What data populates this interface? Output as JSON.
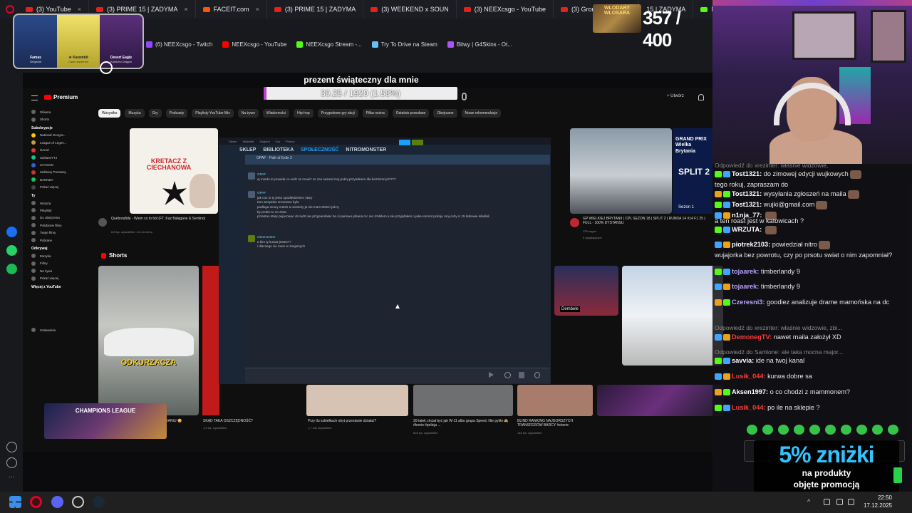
{
  "browser": {
    "tabs": [
      {
        "label": "(3) YouTube",
        "icon": "youtube-icon"
      },
      {
        "label": "(3) PRIME 15 | ZADYMA",
        "icon": "youtube-icon"
      },
      {
        "label": "FACEIT.com",
        "icon": "faceit-icon"
      },
      {
        "label": "(3) PRIME 15 | ZADYMA",
        "icon": "youtube-icon"
      },
      {
        "label": "(3) WEEKEND x SOUN",
        "icon": "youtube-icon"
      },
      {
        "label": "(3) NEEXcsgo - YouTube",
        "icon": "youtube-icon"
      },
      {
        "label": "(3) Gromda 13| Domi",
        "icon": "youtube-icon"
      },
      {
        "label": "15 | ZADYMA",
        "icon": "youtube-icon"
      },
      {
        "label": "N",
        "icon": "kick-icon"
      }
    ],
    "bookmarks": [
      {
        "label": "(6) NEEXcsgo - Twitch",
        "color": "#9146ff"
      },
      {
        "label": "NEEXcsgo - YouTube",
        "color": "#ff0000"
      },
      {
        "label": "NEEXcsgo Stream -...",
        "color": "#53fc18"
      },
      {
        "label": "Try To Drive na Steam",
        "color": "#66c0f4"
      },
      {
        "label": "Bitwy | G4Skins - Ot...",
        "color": "#a855f7"
      }
    ]
  },
  "skins": [
    {
      "name": "Famas",
      "sub": "Sergeant"
    },
    {
      "name": "★ Karambit",
      "sub": "Case Hardened"
    },
    {
      "name": "Desert Eagle",
      "sub": "Kumicho Dragon"
    }
  ],
  "counter": {
    "label": "WLODARY WLOSARA",
    "value": "357 / 400"
  },
  "goal": {
    "title": "prezent świąteczny dla mnie",
    "progress_text": "30.25 / 1920 (1.58%)",
    "percent": 1.58,
    "accent": "#c23bd8"
  },
  "youtube": {
    "logo": "Premium",
    "create": "+ Utwórz",
    "chips": [
      "Wszystko",
      "Muzyka",
      "Gry",
      "Podcasty",
      "Playlisty YouTube Mix",
      "Na żywo",
      "Wiadomości",
      "Hip-hop",
      "Przygodowe gry akcji",
      "Piłka nożna",
      "Ostatnio przesłane",
      "Obejrzane",
      "Nowe rekomendacje"
    ],
    "sidebar": {
      "main": [
        "Główna",
        "Shorts"
      ],
      "subs_title": "Subskrypcje",
      "subs": [
        "National Geogra...",
        "League of Legen...",
        "isAmd",
        "SzklaneYTJ",
        "SAYGON",
        "Zaśbany Pozwany",
        "BANNDA",
        "Pokaż więcej"
      ],
      "you_title": "Ty",
      "you": [
        "Historia",
        "Playlisty",
        "Do obejrzenia",
        "Polubione filmy",
        "Twoje filmy",
        "Pobrane"
      ],
      "explore_title": "Odkrywaj",
      "explore": [
        "Muzyka",
        "Filmy",
        "Na żywo",
        "Pokaż więcej"
      ],
      "more_title": "Więcej z YouTube",
      "settings": "Ustawienia"
    },
    "videos": {
      "kret_title": "Queborafide - Wiem co to ból (FT. Kaz Bałagane & Sentino)",
      "kret_meta": "8,8 tys. wyświetleń • 10 dni temu",
      "kret_banner": "KRETACZ Z CIECHANOWA",
      "f1_title": "GP WIELKIEJ BRYTANII | CPL SEZON 18 | SPLIT 2 | RUNDA 14 #14 F1 25 | FULL - 100% DYSTANSU",
      "f1_channel": "CPLeague",
      "f1_meta": "5 oglądających",
      "f1_banner": "GRAND PRIX Wielka Brytania",
      "f1_split": "SPLIT 2",
      "f1_season": "Sezon 1"
    },
    "shorts_title": "Shorts",
    "shorts": {
      "odk_label": "ODKURZACZA",
      "barca_label": "Dembele",
      "b1": "SKĄD TAKA OSZCZĘDNOŚĆ?",
      "b1_meta": "1,4 tys. wyświetleń",
      "b2": "Przy tlu szkiełkach obyt przestanie działać?",
      "b2_meta": "1,7 mln wyświetleń",
      "b3": "20-latek chciał być jak W-11 albo grupa Speed. Nie pykło 🙈 #konin #policja ...",
      "b3_meta": "803 tys. wyświetleń",
      "b4": "BLIND RANKING NAJGORSZYCH TRANSFERÓW BARCY #shorts",
      "b4_meta": "164 tys. wyświetleń",
      "b0": "DANIU 😊",
      "champions": "CHAMPIONS LEAGUE"
    }
  },
  "steam": {
    "nav": [
      "SKLEP",
      "BIBLIOTEKA",
      "SPOŁECZNOŚĆ",
      "NITROMONSTER"
    ],
    "menu": [
      "Steam",
      "Wyświetl",
      "Znajomi",
      "Gry",
      "Pomoc"
    ],
    "chat_header": "OPAF · Path of Exile 2",
    "messages": [
      {
        "name": "OPAF",
        "lines": [
          "ej mordo to prawda co widz mi mowi? ze zes nazwal moj pokoj przytulkiem dla bezdomnych???"
        ]
      },
      {
        "name": "OPAF",
        "lines": [
          "jak cos to ty jestu upodledzeniec stary",
          "tam wszystko zrownane bylo",
          "podloga scany meble a miesiety ja nie mam 50min jak ty",
          "by probic to ze zlota",
          "przestan stary pejacowac do ludzi sie przypierdalac bo ci panowo jebana mc nie zrobilem a sie przyjebales o jaka remont pokoju moj cehy ci 15 latkowie kilaklali"
        ]
      },
      {
        "name": "nitromonster",
        "lines": [
          "a kim ty kurwa jestes??",
          "i dlaczego cie mam w znajomych"
        ]
      }
    ]
  },
  "chat": {
    "lines": [
      {
        "user": "",
        "text": "Odpowiedź do xrezinter: właśnie widzowie,",
        "reply": true,
        "color": "#8a8a8a"
      },
      {
        "user": "Tost1321:",
        "text": "do zimowej edycji wujkowych",
        "color": "#ffffff"
      },
      {
        "user": "",
        "text": "tego rokuj, zapraszam do",
        "color": "#e6e6e6"
      },
      {
        "user": "Tost1321:",
        "text": "wysyłania zgłoszeń na maila",
        "color": "#ffffff"
      },
      {
        "user": "Tost1321:",
        "text": "wujki@gmail.com",
        "color": "#ffffff"
      },
      {
        "user": "n1nja_77:",
        "text": "",
        "color": "#ffffff"
      },
      {
        "user": "",
        "text": "a ten roast jest w katowicach ?",
        "color": "#e6e6e6"
      },
      {
        "user": "WRZUTA:",
        "text": "",
        "color": "#ffffff"
      },
      {
        "user": "piotrek2103:",
        "text": "powiedział nitro",
        "color": "#ffffff"
      },
      {
        "user": "",
        "text": "wujajorka bez powrotu, czy po prsotu swiat o nim zapomniał?",
        "color": "#e6e6e6"
      },
      {
        "user": "tojaarek:",
        "text": "timberlandy 9",
        "color": "#b9a2ff"
      },
      {
        "user": "tojaarek:",
        "text": "timberlandy 9",
        "color": "#b9a2ff"
      },
      {
        "user": "Czeresni3:",
        "text": "goodiez analizuje drame mamońska na dc",
        "color": "#b9a2ff"
      },
      {
        "user": "",
        "text": "Odpowiedź do xrezinter: właśnie widzowie, zbi...",
        "reply": true,
        "color": "#8a8a8a"
      },
      {
        "user": "DemonegTV:",
        "text": "nawet maila założył XD",
        "color": "#ff3a3a"
      },
      {
        "user": "",
        "text": "Odpowiedź do Samlone: ale taka mocna major...",
        "reply": true,
        "color": "#8a8a8a"
      },
      {
        "user": "savvia:",
        "text": "ide na twoj kanal",
        "color": "#ffffff"
      },
      {
        "user": "Lusik_044:",
        "text": "kurwa dobre sa",
        "color": "#ff3a3a"
      },
      {
        "user": "Aksen1997:",
        "text": "o co chodzi z mammonem?",
        "color": "#ffffff"
      },
      {
        "user": "Lusik_044:",
        "text": "po ile na sklepie ?",
        "color": "#ff3a3a"
      }
    ]
  },
  "promo": {
    "big": "5% zniżki",
    "line1": "na produkty",
    "line2": "objęte promocją",
    "color": "#33c4ff"
  },
  "taskbar": {
    "time": "22:50",
    "date": "17.12.2025"
  }
}
